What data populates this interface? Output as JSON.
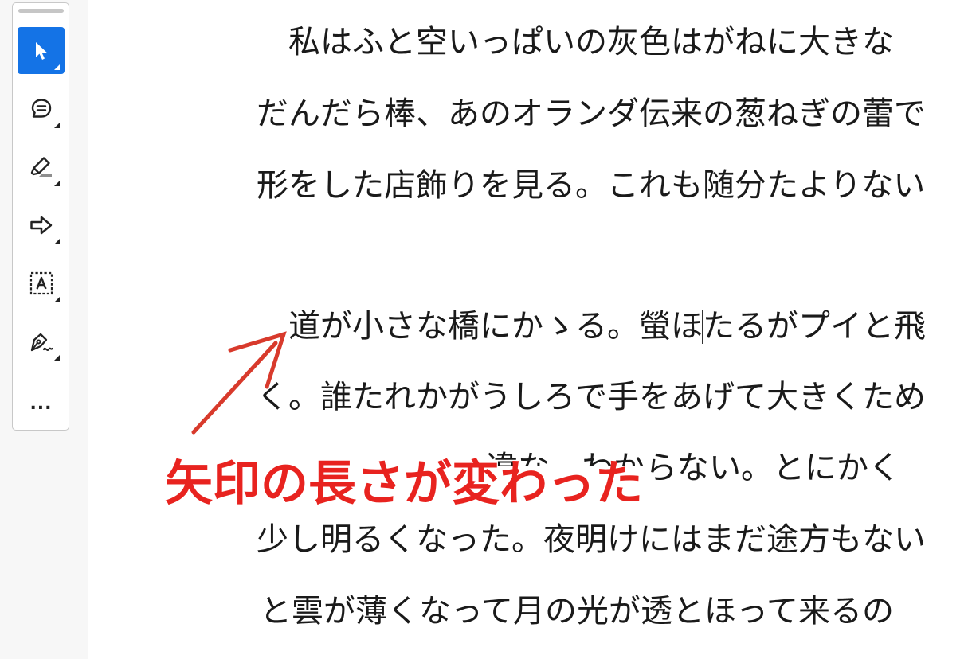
{
  "toolbar": {
    "tools": [
      {
        "name": "select-tool",
        "icon": "pointer-arrow-icon",
        "active": true
      },
      {
        "name": "comment-tool",
        "icon": "comment-bubble-icon",
        "active": false
      },
      {
        "name": "highlight-tool",
        "icon": "highlighter-pen-icon",
        "active": false
      },
      {
        "name": "arrow-tool",
        "icon": "outline-arrow-right-icon",
        "active": false
      },
      {
        "name": "text-box-tool",
        "icon": "text-box-A-icon",
        "active": false
      },
      {
        "name": "draw-tool",
        "icon": "pen-nib-icon",
        "active": false
      }
    ],
    "more_label": "..."
  },
  "document": {
    "lines": [
      "　私はふと空いっぱいの灰色はがねに大きな",
      "だんだら棒、あのオランダ伝来の葱ねぎの蕾で",
      "形をした店飾りを見る。これも随分たよりない",
      "　道が小さな橋にかゝる。螢ほたるがプイと飛",
      "く。誰たれかがうしろで手をあげて大きくため",
      "違な　わからない。とにかく",
      "少し明るくなった。夜明けにはまだ途方もない",
      "と雲が薄くなって月の光が透とほって来るの"
    ]
  },
  "annotation": {
    "text": "矢印の長さが変わった",
    "color": "#e8231f"
  },
  "accent_color": "#1473e6"
}
